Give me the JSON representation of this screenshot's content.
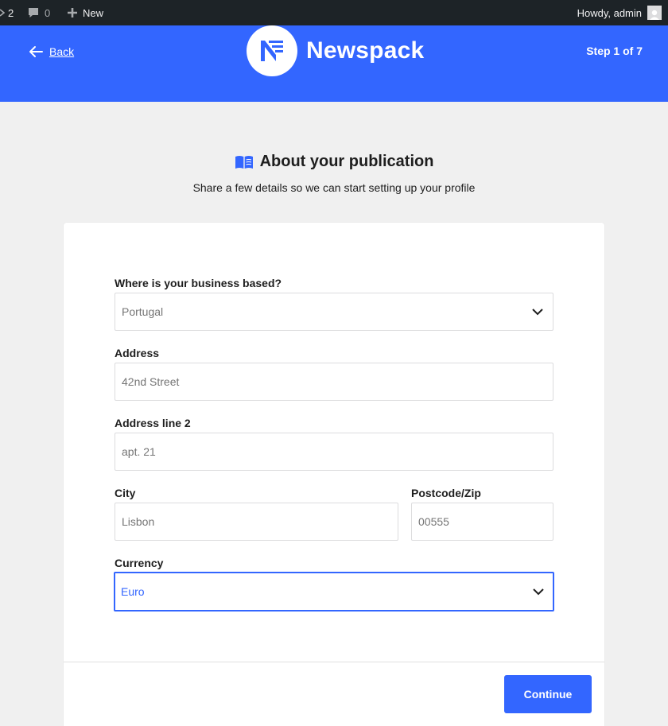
{
  "adminbar": {
    "updates_count": "2",
    "comments_count": "0",
    "new_label": "New",
    "howdy": "Howdy, admin"
  },
  "header": {
    "back_label": "Back",
    "brand": "Newspack",
    "step": "Step 1 of 7",
    "color": "#3366ff"
  },
  "page": {
    "title": "About your publication",
    "subtitle": "Share a few details so we can start setting up your profile"
  },
  "form": {
    "country": {
      "label": "Where is your business based?",
      "value": "Portugal"
    },
    "address": {
      "label": "Address",
      "value": "42nd Street"
    },
    "address2": {
      "label": "Address line 2",
      "value": "apt. 21"
    },
    "city": {
      "label": "City",
      "value": "Lisbon"
    },
    "postcode": {
      "label": "Postcode/Zip",
      "value": "00555"
    },
    "currency": {
      "label": "Currency",
      "value": "Euro"
    }
  },
  "actions": {
    "continue_label": "Continue"
  },
  "icons": {
    "back": "arrow-left-icon",
    "title": "book-icon",
    "select": "chevron-down-icon"
  }
}
